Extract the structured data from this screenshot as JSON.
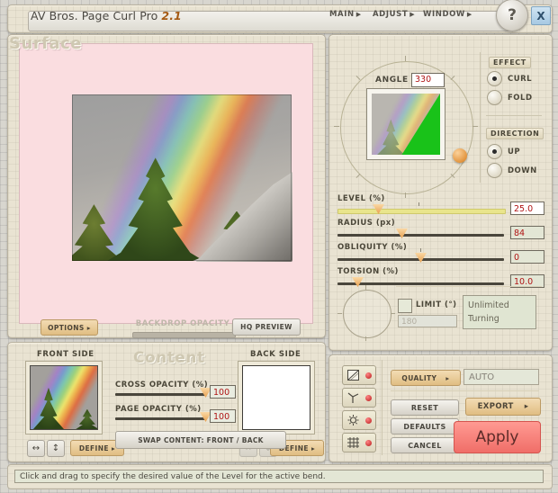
{
  "titlebar": {
    "app_name": "AV Bros. Page Curl Pro",
    "version": "2.1",
    "menus": [
      {
        "label": "MAIN",
        "arrow": "▶"
      },
      {
        "label": "ADJUST",
        "arrow": "▶"
      },
      {
        "label": "WINDOW",
        "arrow": "▶"
      }
    ],
    "help_label": "?",
    "close_label": "X"
  },
  "preview": {
    "options_label": "OPTIONS ▸",
    "backdrop_opacity_label": "BACKDROP OPACITY",
    "hq_preview_label": "HQ PREVIEW"
  },
  "surface": {
    "title": "Surface",
    "angle_label": "ANGLE",
    "angle_value": "330",
    "effect_head": "EFFECT",
    "effect_options": [
      {
        "label": "CURL",
        "selected": true
      },
      {
        "label": "FOLD",
        "selected": false
      }
    ],
    "direction_head": "DIRECTION",
    "direction_options": [
      {
        "label": "UP",
        "selected": true
      },
      {
        "label": "DOWN",
        "selected": false
      }
    ],
    "sliders": [
      {
        "label": "LEVEL (%)",
        "value": "25.0"
      },
      {
        "label": "RADIUS (px)",
        "value": "84"
      },
      {
        "label": "OBLIQUITY (%)",
        "value": "0"
      },
      {
        "label": "TORSION (%)",
        "value": "10.0"
      }
    ],
    "limit_label": "LIMIT (°)",
    "limit_value": "180",
    "turning_text": "Unlimited Turning"
  },
  "content": {
    "title": "Content",
    "front_side_label": "FRONT SIDE",
    "back_side_label": "BACK SIDE",
    "cross_opacity_label": "CROSS OPACITY (%)",
    "cross_opacity_value": "100",
    "page_opacity_label": "PAGE OPACITY (%)",
    "page_opacity_value": "100",
    "swap_label": "SWAP CONTENT: FRONT / BACK",
    "define_label": "DEFINE ▸",
    "flip_h_glyph": "↔",
    "flip_v_glyph": "↕"
  },
  "actions": {
    "quality_label": "QUALITY",
    "quality_arrow": "▸",
    "quality_value": "AUTO",
    "reset_label": "RESET",
    "defaults_label": "DEFAULTS",
    "cancel_label": "CANCEL",
    "export_label": "EXPORT",
    "export_arrow": "▸",
    "apply_label": "Apply",
    "toggles": [
      {
        "name": "page-curl-preview"
      },
      {
        "name": "axis-preview"
      },
      {
        "name": "light-preview"
      },
      {
        "name": "grid-preview"
      }
    ]
  },
  "statusbar": {
    "message": "Click and drag to specify the desired value of the Level for the active bend."
  },
  "colors": {
    "panel": "#e9e3d2",
    "accent_orange": "#e0bd82",
    "apply_red": "#f06e68",
    "value_red": "#b01414",
    "backdrop_pink": "#fadde0"
  }
}
